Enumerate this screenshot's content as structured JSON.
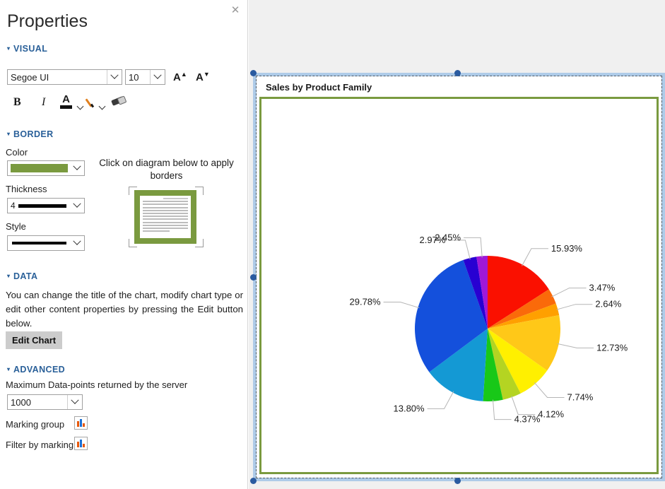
{
  "panel": {
    "title": "Properties",
    "close_icon": "close-icon",
    "sections": {
      "visual": {
        "header": "VISUAL",
        "font_family_value": "Segoe UI",
        "font_size_value": "10",
        "increase_font_label": "A",
        "decrease_font_label": "A",
        "bold_label": "B",
        "italic_label": "I",
        "font_color_label": "A",
        "icons": [
          "bold-icon",
          "italic-icon",
          "font-color-icon",
          "highlight-pen-icon",
          "eraser-icon"
        ]
      },
      "border": {
        "header": "BORDER",
        "color_label": "Color",
        "color_value": "#7a9a3f",
        "thickness_label": "Thickness",
        "thickness_value": "4",
        "style_label": "Style",
        "style_value": "solid",
        "hint": "Click on diagram below to apply borders"
      },
      "data": {
        "header": "DATA",
        "description": "You can change the title of the chart, modify chart type or edit other content properties by pressing the Edit button below.",
        "edit_chart_label": "Edit Chart"
      },
      "advanced": {
        "header": "ADVANCED",
        "max_datapoints_label": "Maximum Data-points returned by the server",
        "max_datapoints_value": "1000",
        "marking_group_label": "Marking group",
        "filter_by_marking_label": "Filter by marking"
      }
    }
  },
  "canvas": {
    "chart_title": "Sales by Product Family"
  },
  "chart_data": {
    "type": "pie",
    "title": "Sales by Product Family",
    "labels": [
      "15.93%",
      "3.47%",
      "2.64%",
      "12.73%",
      "7.74%",
      "4.12%",
      "4.37%",
      "13.80%",
      "29.78%",
      "2.97%",
      "2.45%"
    ],
    "values": [
      15.93,
      3.47,
      2.64,
      12.73,
      7.74,
      4.12,
      4.37,
      13.8,
      29.78,
      2.97,
      2.45
    ],
    "colors": [
      "#fa1000",
      "#fa6a0a",
      "#ffa000",
      "#ffc818",
      "#fff000",
      "#b4d422",
      "#18c818",
      "#1499d4",
      "#1450dc",
      "#2800d2",
      "#a018d8"
    ],
    "legend": "none",
    "start_angle_deg": 0,
    "direction": "clockwise",
    "label_format": "percent"
  }
}
